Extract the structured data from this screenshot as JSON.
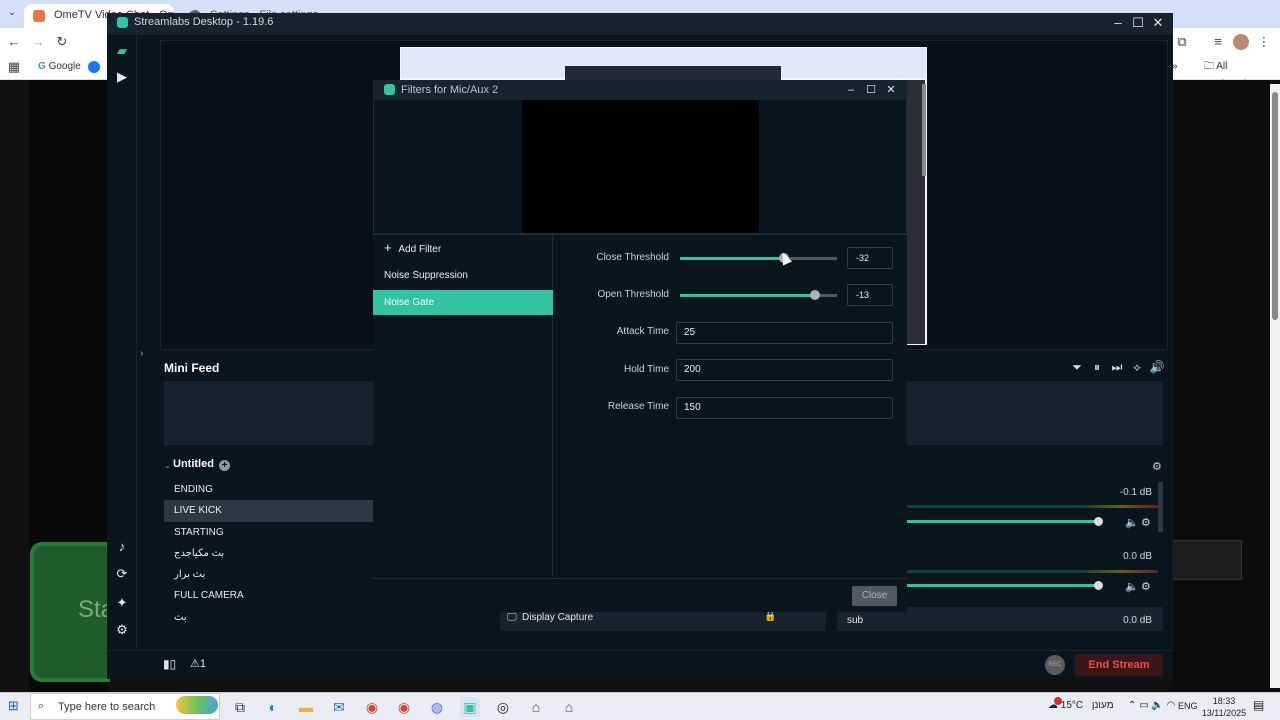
{
  "browser": {
    "tab1_title": "OmeTV Video Chat - Omegle",
    "tab2_title": "Settings - File settings",
    "bookmark_google": "Google",
    "bookmarks_all": "All Bookmarks"
  },
  "page": {
    "green_text": "Sta"
  },
  "streamlabs": {
    "title": "Streamlabs Desktop - 1.19.6",
    "minifeed": "Mini Feed",
    "scene_collection": "Untitled",
    "scenes": [
      {
        "label": "ENDING"
      },
      {
        "label": "LIVE KICK"
      },
      {
        "label": "STARTING"
      },
      {
        "label": "بث مكياجدج"
      },
      {
        "label": "بث برار"
      },
      {
        "label": "FULL CAMERA"
      },
      {
        "label": "بث"
      }
    ],
    "source_label": "Display Capture",
    "mixer": {
      "db1": "-0.1 dB",
      "db2": "0.0 dB",
      "db3": "0.0 dB",
      "source3": "sub",
      "slider1_level": 0.8,
      "slider2_level": 0.8
    },
    "footer": {
      "alert_count": "1",
      "rec_label": "REC",
      "end_stream": "End Stream"
    }
  },
  "filters_dialog": {
    "title": "Filters for Mic/Aux 2",
    "add_filter": "Add Filter",
    "filters": [
      {
        "label": "Noise Suppression",
        "active": false
      },
      {
        "label": "Noise Gate",
        "active": true
      }
    ],
    "close_threshold": {
      "label": "Close Threshold",
      "value": "-32",
      "level": 0.66
    },
    "open_threshold": {
      "label": "Open Threshold",
      "value": "-13",
      "level": 0.86
    },
    "attack_time": {
      "label": "Attack Time",
      "value": "25"
    },
    "hold_time": {
      "label": "Hold Time",
      "value": "200"
    },
    "release_time": {
      "label": "Release Time",
      "value": "150"
    },
    "close_button": "Close"
  },
  "taskbar": {
    "search_placeholder": "Type here to search",
    "weather": "15°C",
    "weather_desc": "מעונן",
    "lang": "ENG",
    "time": "18:33",
    "date": "13/11/2025"
  },
  "icons": {
    "accent": "#31c3a2",
    "end_stream_color": "#f04a4a"
  }
}
